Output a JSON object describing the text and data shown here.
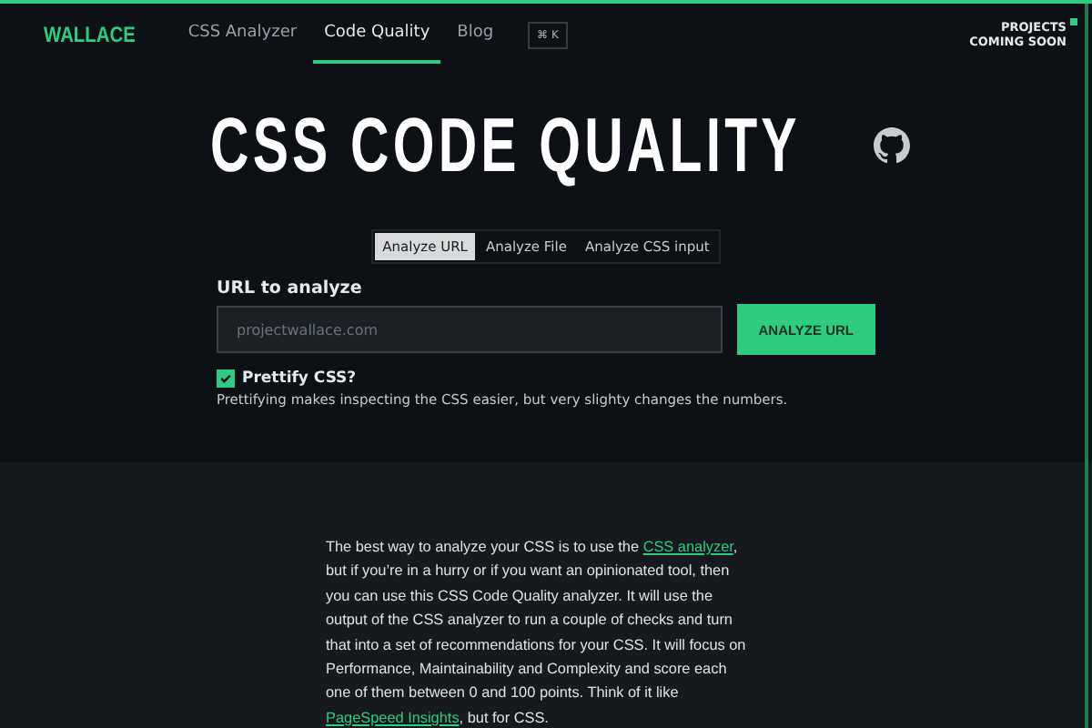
{
  "nav": {
    "logo": "WALLACE",
    "items": [
      {
        "label": "CSS Analyzer",
        "selected": false
      },
      {
        "label": "Code Quality",
        "selected": true
      },
      {
        "label": "Blog",
        "selected": false
      }
    ],
    "shortcut": "⌘ K",
    "projects": [
      "PROJECTS",
      "COMING SOON"
    ]
  },
  "hero": {
    "title": "CSS CODE QUALITY",
    "tabs": [
      {
        "label": "Analyze URL",
        "selected": true
      },
      {
        "label": "Analyze File",
        "selected": false
      },
      {
        "label": "Analyze CSS input",
        "selected": false
      }
    ],
    "field_label": "URL to analyze",
    "placeholder": "projectwallace.com",
    "button": "ANALYZE URL",
    "prettify": {
      "label": "Prettify CSS?",
      "checked": true,
      "hint": "Prettifying makes inspecting the CSS easier, but very slighty changes the numbers."
    }
  },
  "intro": [
    {
      "kind": "text",
      "text": "The best way to analyze your CSS is to use the "
    },
    {
      "kind": "link",
      "text": "CSS analyzer"
    },
    {
      "kind": "text",
      "text": ", but if you’re in a hurry or if you want an opinionated tool, then you can use this CSS Code Quality analyzer. It will use the output of the CSS analyzer to run a couple of checks and turn that into a set of recommendations for your CSS. It will focus on Performance, Maintainability and Complexity and score each one of them between 0 and 100 points. Think of it like "
    },
    {
      "kind": "link",
      "text": "PageSpeed Insights"
    },
    {
      "kind": "text",
      "text": ", but for CSS."
    }
  ]
}
